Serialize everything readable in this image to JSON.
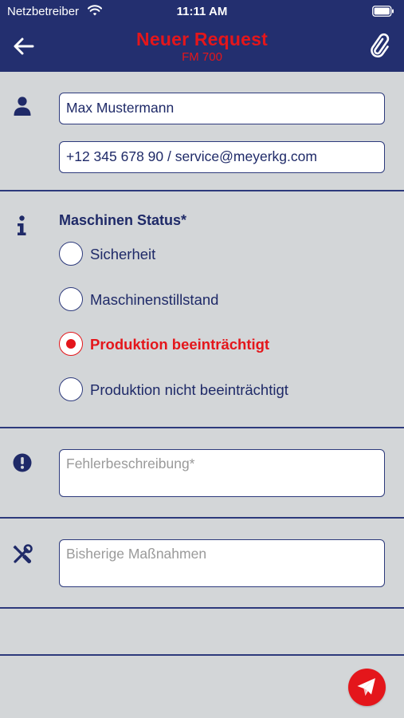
{
  "status_bar": {
    "carrier": "Netzbetreiber",
    "time": "11:11 AM"
  },
  "header": {
    "title": "Neuer Request",
    "subtitle": "FM 700",
    "back_icon": "arrow-left-icon",
    "attach_icon": "paperclip-icon"
  },
  "contact": {
    "icon": "user-icon",
    "name_value": "Max Mustermann",
    "contact_value": "+12 345 678 90 / service@meyerkg.com"
  },
  "machine_status": {
    "icon": "info-icon",
    "label": "Maschinen Status*",
    "options": [
      {
        "label": "Sicherheit",
        "selected": false
      },
      {
        "label": "Maschinenstillstand",
        "selected": false
      },
      {
        "label": "Produktion beeinträchtigt",
        "selected": true
      },
      {
        "label": "Produktion nicht beeinträchtigt",
        "selected": false
      }
    ]
  },
  "error_description": {
    "icon": "exclamation-icon",
    "placeholder": "Fehlerbeschreibung*"
  },
  "measures": {
    "icon": "tools-icon",
    "placeholder": "Bisherige Maßnahmen"
  },
  "send": {
    "icon": "paper-plane-icon"
  },
  "colors": {
    "primary": "#232f6f",
    "accent": "#e4161b",
    "background": "#d3d6d8",
    "text": "#1f2a68"
  }
}
